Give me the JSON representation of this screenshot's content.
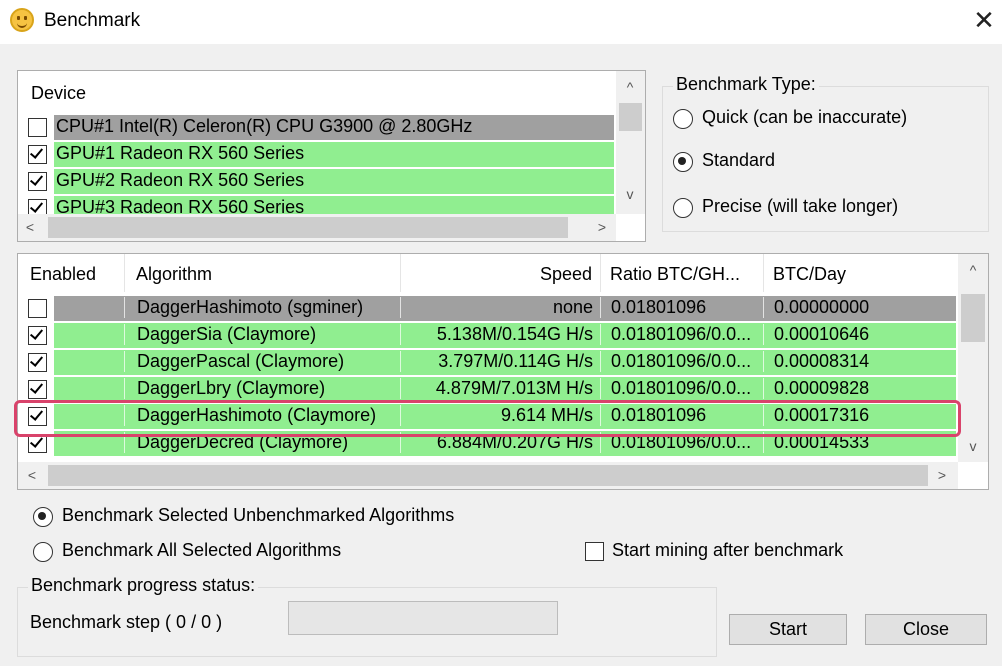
{
  "window": {
    "title": "Benchmark",
    "close_glyph": "✕"
  },
  "devices": {
    "header": "Device",
    "items": [
      {
        "label": "CPU#1 Intel(R) Celeron(R) CPU G3900 @ 2.80GHz",
        "checked": false,
        "row_color": "#a0a0a0"
      },
      {
        "label": "GPU#1 Radeon RX 560 Series",
        "checked": true,
        "row_color": "#90ee90"
      },
      {
        "label": "GPU#2 Radeon RX 560 Series",
        "checked": true,
        "row_color": "#90ee90"
      },
      {
        "label": "GPU#3 Radeon RX 560 Series",
        "checked": true,
        "row_color": "#90ee90"
      }
    ]
  },
  "benchmark_type": {
    "label": "Benchmark Type:",
    "options": [
      {
        "label": "Quick (can be inaccurate)",
        "selected": false
      },
      {
        "label": "Standard",
        "selected": true
      },
      {
        "label": "Precise (will take longer)",
        "selected": false
      }
    ]
  },
  "algorithms": {
    "columns": [
      "Enabled",
      "Algorithm",
      "Speed",
      "Ratio BTC/GH...",
      "BTC/Day"
    ],
    "rows": [
      {
        "enabled": false,
        "algorithm": "DaggerHashimoto (sgminer)",
        "speed": "none",
        "ratio": "0.01801096",
        "btc_day": "0.00000000",
        "row_color": "#a0a0a0"
      },
      {
        "enabled": true,
        "algorithm": "DaggerSia (Claymore)",
        "speed": "5.138M/0.154G H/s",
        "ratio": "0.01801096/0.0...",
        "btc_day": "0.00010646",
        "row_color": "#90ee90"
      },
      {
        "enabled": true,
        "algorithm": "DaggerPascal (Claymore)",
        "speed": "3.797M/0.114G H/s",
        "ratio": "0.01801096/0.0...",
        "btc_day": "0.00008314",
        "row_color": "#90ee90"
      },
      {
        "enabled": true,
        "algorithm": "DaggerLbry (Claymore)",
        "speed": "4.879M/7.013M H/s",
        "ratio": "0.01801096/0.0...",
        "btc_day": "0.00009828",
        "row_color": "#90ee90"
      },
      {
        "enabled": true,
        "algorithm": "DaggerHashimoto (Claymore)",
        "speed": "9.614 MH/s",
        "ratio": "0.01801096",
        "btc_day": "0.00017316",
        "row_color": "#90ee90",
        "highlighted": true
      },
      {
        "enabled": true,
        "algorithm": "DaggerDecred (Claymore)",
        "speed": "6.884M/0.207G H/s",
        "ratio": "0.01801096/0.0...",
        "btc_day": "0.00014533",
        "row_color": "#90ee90"
      }
    ]
  },
  "scope": {
    "options": [
      {
        "label": "Benchmark Selected Unbenchmarked Algorithms",
        "selected": true
      },
      {
        "label": "Benchmark All Selected Algorithms",
        "selected": false
      }
    ]
  },
  "start_mining": {
    "label": "Start mining after benchmark",
    "checked": false
  },
  "progress": {
    "group_label": "Benchmark progress status:",
    "step_text": "Benchmark step ( 0 / 0 )",
    "value": 0
  },
  "buttons": {
    "start": "Start",
    "close": "Close"
  },
  "scroll_arrows": {
    "up": "^",
    "down": "v",
    "left": "<",
    "right": ">"
  },
  "colors": {
    "enabled_row": "#90ee90",
    "disabled_row": "#a0a0a0",
    "highlight": "#d9436b"
  }
}
